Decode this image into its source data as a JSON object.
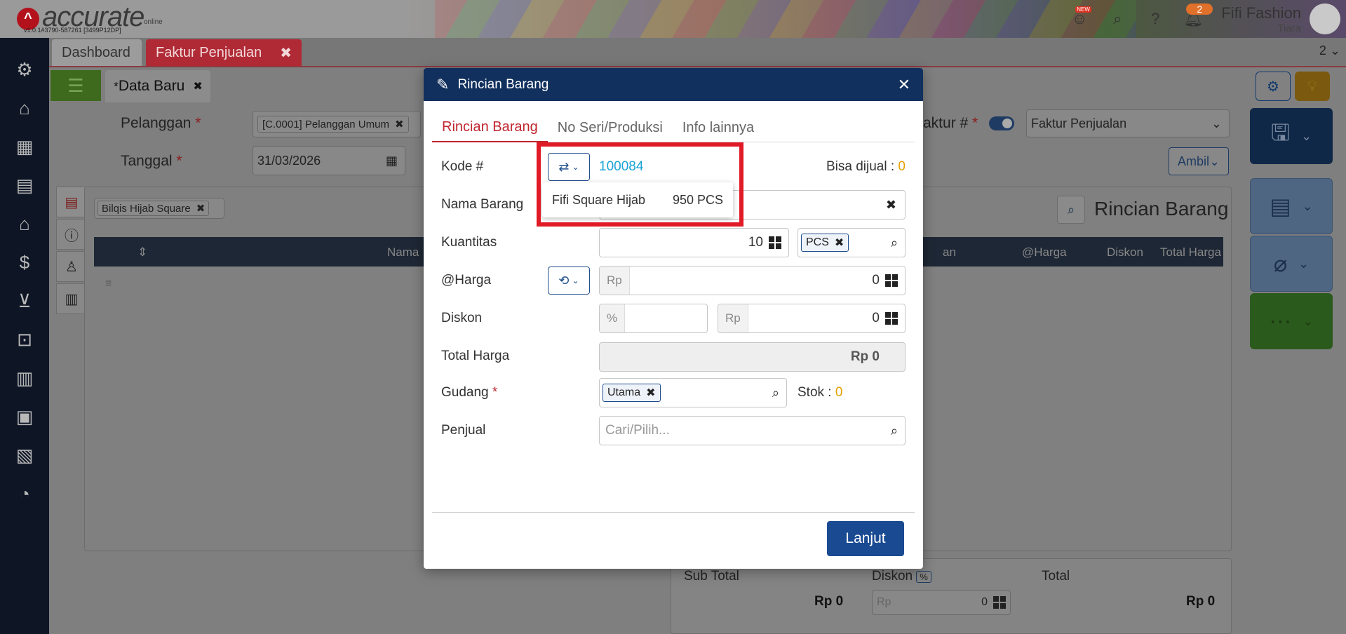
{
  "app": {
    "logo_text": "accurate",
    "logo_sub": "online",
    "version": "v1.0.1#3790-587261 [3499P12DP]",
    "new_badge": "NEW",
    "notif_count": "2",
    "user_name": "Fifi Fashion",
    "user_sub": "Tiara"
  },
  "tabs": {
    "dashboard": "Dashboard",
    "faktur": "Faktur Penjualan",
    "count": "2"
  },
  "page": {
    "subtab_new": "Data Baru",
    "pelanggan_label": "Pelanggan",
    "pelanggan_value": "[C.0001] Pelanggan Umum",
    "tanggal_label": "Tanggal",
    "tanggal_value": "31/03/2026",
    "faktur_label": "aktur #",
    "faktur_type": "Faktur Penjualan",
    "ambil": "Ambil",
    "chip_item": "Bilqis Hijab Square",
    "panel_title": "Rincian Barang",
    "col_nama": "Nama",
    "col_an": "an",
    "col_harga": "@Harga",
    "col_diskon": "Diskon",
    "col_total": "Total Harga",
    "subtotal_label": "Sub Total",
    "subtotal_value": "Rp 0",
    "diskon_label": "Diskon",
    "diskon_pct": "%",
    "diskon_prefix": "Rp",
    "diskon_value": "0",
    "total_label": "Total",
    "total_value": "Rp 0"
  },
  "modal": {
    "title": "Rincian Barang",
    "tabs": [
      "Rincian Barang",
      "No Seri/Produksi",
      "Info lainnya"
    ],
    "kode_label": "Kode #",
    "kode_value": "100084",
    "bisa_dijual_label": "Bisa dijual :",
    "bisa_dijual_value": "0",
    "nama_label": "Nama Barang",
    "kuantitas_label": "Kuantitas",
    "kuantitas_value": "10",
    "satuan": "PCS",
    "harga_label": "@Harga",
    "harga_prefix": "Rp",
    "harga_value": "0",
    "diskon_label": "Diskon",
    "diskon_pct_prefix": "%",
    "diskon_rp_prefix": "Rp",
    "diskon_value": "0",
    "total_label": "Total Harga",
    "total_value": "Rp 0",
    "gudang_label": "Gudang",
    "gudang_value": "Utama",
    "stok_label": "Stok :",
    "stok_value": "0",
    "penjual_label": "Penjual",
    "penjual_placeholder": "Cari/Pilih...",
    "lanjut": "Lanjut"
  },
  "autocomplete": {
    "item_name": "Fifi Square Hijab",
    "item_stock": "950 PCS"
  },
  "colors": {
    "header": "#11305d",
    "accent_red": "#c0262f",
    "primary_button": "#1a4a92",
    "highlight": "#e01a26",
    "code_link": "#1aa3d6",
    "stock_value": "#e6a100"
  }
}
